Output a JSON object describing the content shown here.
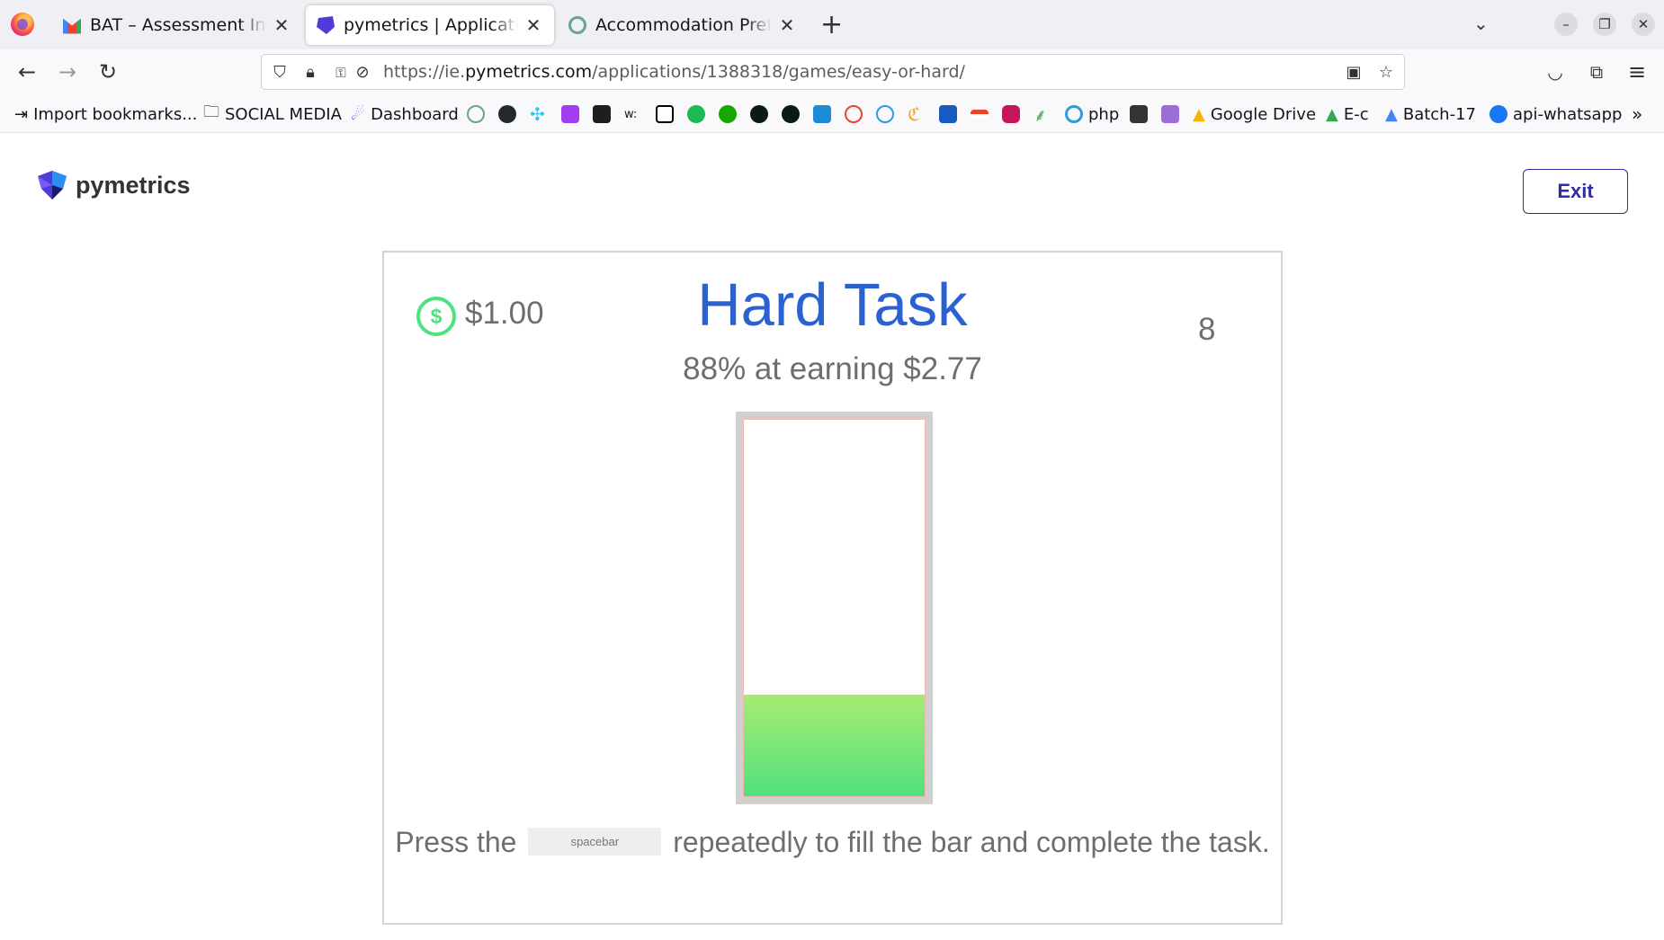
{
  "browser": {
    "tabs": [
      {
        "title": "BAT – Assessment Invitation",
        "favicon": "gmail-icon",
        "active": false
      },
      {
        "title": "pymetrics | Application - Easy or Hard",
        "favicon": "pymetrics-icon",
        "active": true
      },
      {
        "title": "Accommodation Preferences",
        "favicon": "openai-icon",
        "active": false
      }
    ],
    "url": {
      "prefix": "https://ie.",
      "host": "pymetrics.com",
      "path": "/applications/1388318/games/easy-or-hard/"
    },
    "bookmarks": [
      {
        "label": "Import bookmarks...",
        "icon": "import-icon"
      },
      {
        "label": "SOCIAL MEDIA",
        "icon": "folder-icon"
      },
      {
        "label": "Dashboard",
        "icon": "dashboard-icon"
      },
      {
        "label": "php",
        "icon": "php-icon"
      },
      {
        "label": "Google Drive",
        "icon": "google-drive-icon"
      },
      {
        "label": "E-c",
        "icon": "google-drive-icon"
      },
      {
        "label": "Batch-17",
        "icon": "google-drive-icon"
      },
      {
        "label": "api-whatsapp",
        "icon": "facebook-icon"
      }
    ],
    "bookmark_icons": [
      "openai-icon",
      "github-icon",
      "slack-icon",
      "purple-play-icon",
      "figma-icon",
      "w-icon",
      "notion-icon",
      "green-f-icon",
      "upwork-icon",
      "dark-circle-icon",
      "dark-circle-icon",
      "s-icon",
      "face-icon",
      "p-icon",
      "c-icon",
      "word-icon",
      "flag-icon",
      "camera-icon",
      "leaf-icon"
    ]
  },
  "app": {
    "brand": "pymetrics",
    "exit_label": "Exit",
    "currency_icon": "$",
    "balance": "$1.00",
    "task_title": "Hard Task",
    "counter": "8",
    "subtitle": "88% at earning $2.77",
    "progress_fraction": 0.27,
    "instruction_before": "Press the",
    "key_label": "spacebar",
    "instruction_after": "repeatedly to fill the bar and complete the task."
  },
  "colors": {
    "title_blue": "#2b62cf",
    "coin_green": "#4fe07f",
    "exit_border": "#2f2fa0",
    "text_gray": "#6e6e6e"
  }
}
